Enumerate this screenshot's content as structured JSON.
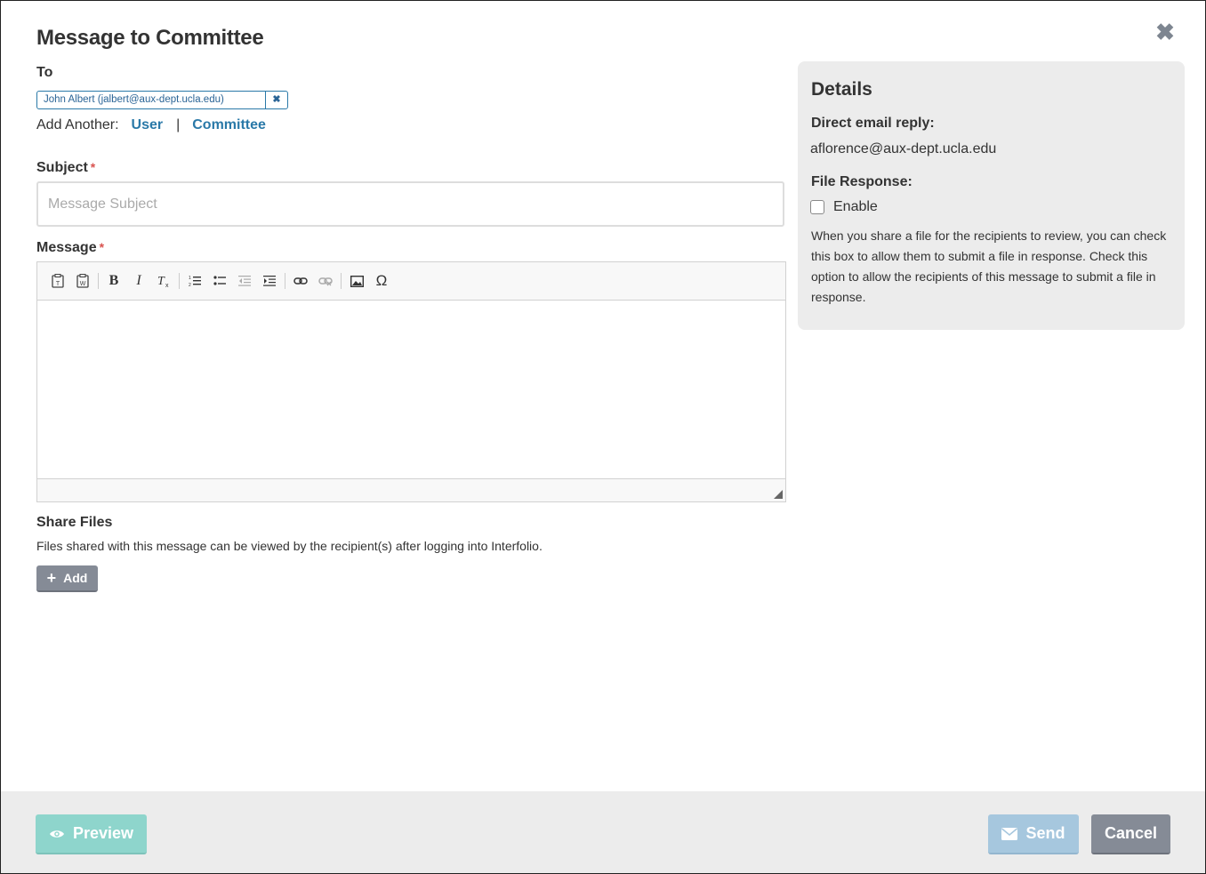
{
  "dialog": {
    "title": "Message to Committee",
    "close_icon": "close-icon"
  },
  "to": {
    "label": "To",
    "recipient": "John Albert (jalbert@aux-dept.ucla.edu)",
    "add_another_label": "Add Another:",
    "add_user_link": "User",
    "separator": "|",
    "add_committee_link": "Committee"
  },
  "subject": {
    "label": "Subject",
    "required_mark": "*",
    "placeholder": "Message Subject",
    "value": ""
  },
  "message": {
    "label": "Message",
    "required_mark": "*",
    "toolbar": [
      "paste-text-icon",
      "paste-word-icon",
      "bold-icon",
      "italic-icon",
      "remove-format-icon",
      "numbered-list-icon",
      "bulleted-list-icon",
      "outdent-icon",
      "indent-icon",
      "link-icon",
      "unlink-icon",
      "image-icon",
      "special-character-icon"
    ],
    "glyphs": {
      "bold": "B",
      "italic": "I",
      "omega": "Ω"
    }
  },
  "share_files": {
    "title": "Share Files",
    "description": "Files shared with this message can be viewed by the recipient(s) after logging into Interfolio.",
    "add_label": "Add",
    "add_icon": "+"
  },
  "details": {
    "title": "Details",
    "direct_reply_label": "Direct email reply:",
    "direct_reply_email": "aflorence@aux-dept.ucla.edu",
    "file_response_label": "File Response:",
    "enable_label": "Enable",
    "enable_checked": false,
    "help_text": "When you share a file for the recipients to review, you can check this box to allow them to submit a file in response. Check this option to allow the recipients of this message to submit a file in response."
  },
  "footer": {
    "preview_label": "Preview",
    "send_label": "Send",
    "cancel_label": "Cancel"
  },
  "colors": {
    "link": "#2a79a8",
    "preview_button": "#8ed5cc",
    "send_button": "#a6c7de",
    "cancel_button": "#858b96",
    "details_panel": "#ececec",
    "required": "#d9534f"
  }
}
